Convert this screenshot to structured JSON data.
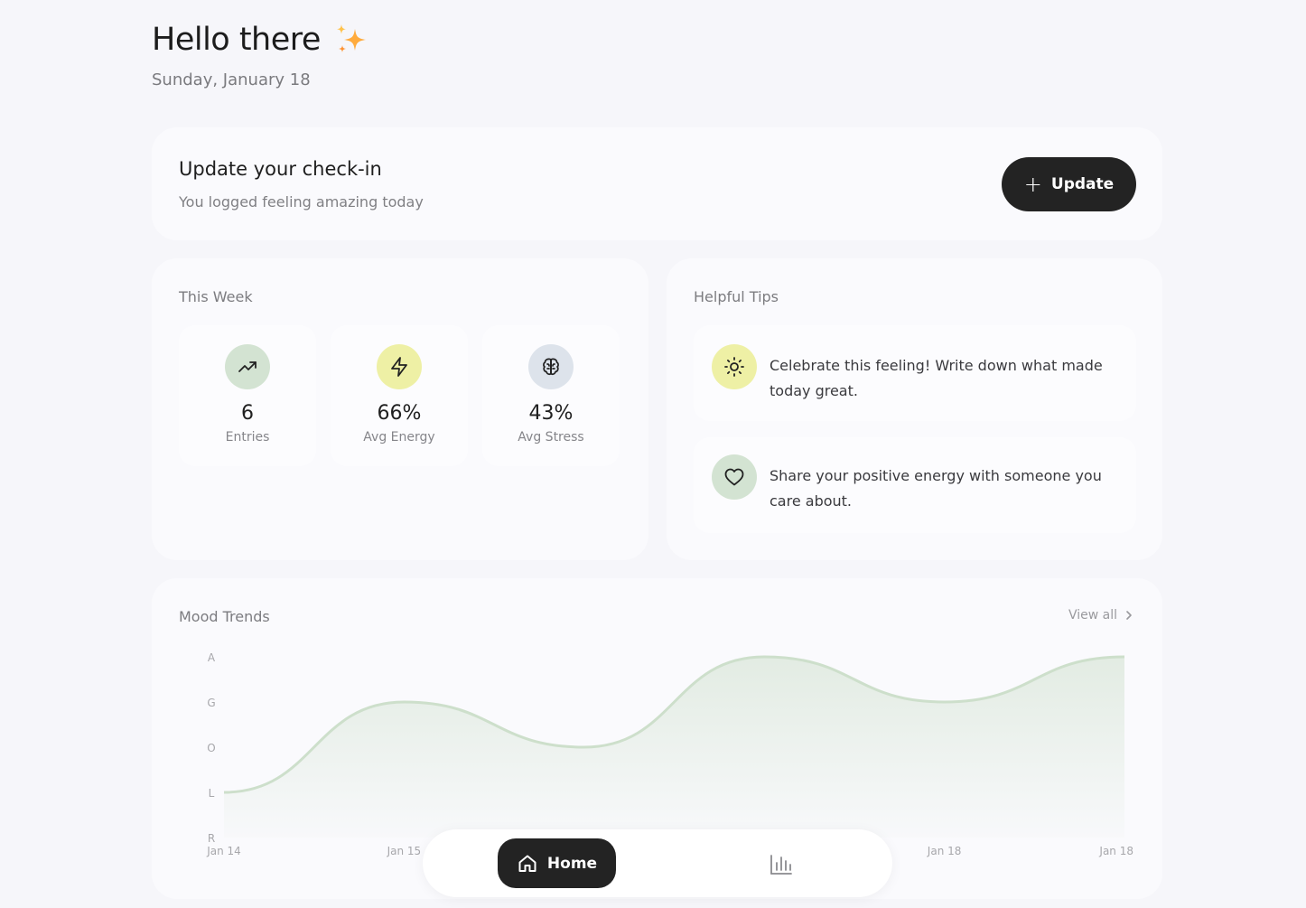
{
  "header": {
    "greeting": "Hello there",
    "date": "Sunday, January 18"
  },
  "checkin": {
    "title": "Update your check-in",
    "subtitle": "You logged feeling amazing today",
    "button_label": "Update"
  },
  "week": {
    "title": "This Week",
    "stats": [
      {
        "value": "6",
        "label": "Entries",
        "icon": "trending-up-icon",
        "color": "#d3e3d2"
      },
      {
        "value": "66%",
        "label": "Avg Energy",
        "icon": "zap-icon",
        "color": "#eef0a5"
      },
      {
        "value": "43%",
        "label": "Avg Stress",
        "icon": "brain-icon",
        "color": "#dde3eb"
      }
    ]
  },
  "tips": {
    "title": "Helpful Tips",
    "items": [
      {
        "text": "Celebrate this feeling! Write down what made today great.",
        "icon": "sun-icon",
        "color": "#eef0a5"
      },
      {
        "text": "Share your positive energy with someone you care about.",
        "icon": "heart-icon",
        "color": "#d3e3d2"
      }
    ]
  },
  "trends": {
    "title": "Mood Trends",
    "view_all": "View all"
  },
  "chart_data": {
    "type": "area",
    "y_levels": [
      "R",
      "L",
      "O",
      "G",
      "A"
    ],
    "x_labels": [
      "Jan 14",
      "Jan 15",
      "Jan 18",
      "Jan 18"
    ],
    "points": [
      {
        "x": "Jan 14",
        "y": 1
      },
      {
        "x": "Jan 15",
        "y": 3
      },
      {
        "x": "",
        "y": 2
      },
      {
        "x": "",
        "y": 4
      },
      {
        "x": "Jan 18",
        "y": 3
      },
      {
        "x": "Jan 18",
        "y": 4
      }
    ],
    "ylim": [
      0,
      4
    ],
    "color": "#cddfcb"
  },
  "nav": {
    "home_label": "Home"
  }
}
